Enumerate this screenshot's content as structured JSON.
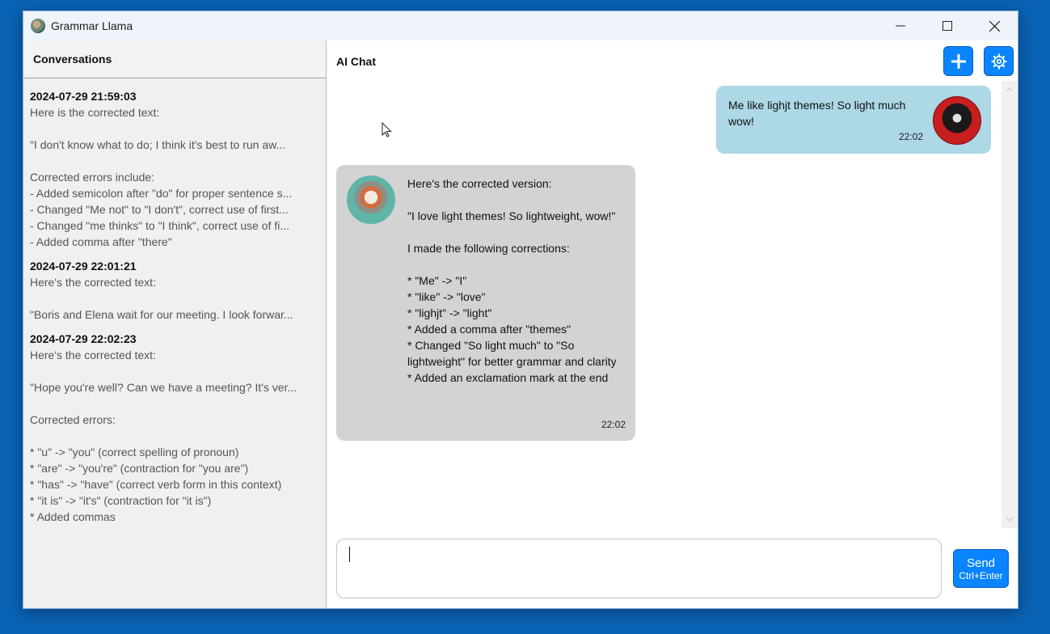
{
  "window": {
    "title": "Grammar Llama"
  },
  "sidebar": {
    "header": "Conversations",
    "conversations": [
      {
        "date": "2024-07-29 21:59:03",
        "lines": [
          "Here is the corrected text:",
          "",
          "\"I don't know what to do; I think it's best to run aw...",
          "",
          "Corrected errors include:",
          "- Added semicolon after \"do\" for proper sentence s...",
          "- Changed \"Me not\" to \"I don't\", correct use of first...",
          "- Changed \"me thinks\" to \"I think\", correct use of fi...",
          "- Added comma after \"there\""
        ]
      },
      {
        "date": "2024-07-29 22:01:21",
        "lines": [
          "Here's the corrected text:",
          "",
          "\"Boris and Elena wait for our meeting. I look forwar..."
        ]
      },
      {
        "date": "2024-07-29 22:02:23",
        "lines": [
          "Here's the corrected text:",
          "",
          "\"Hope you're well? Can we have a meeting? It's ver...",
          "",
          "Corrected errors:",
          "",
          "* \"u\" -> \"you\" (correct spelling of pronoun)",
          "* \"are\" -> \"you're\" (contraction for \"you are\")",
          "* \"has\" -> \"have\" (correct verb form in this context)",
          "* \"it is\" -> \"it's\" (contraction for \"it is\")",
          "* Added commas"
        ]
      }
    ]
  },
  "chat": {
    "title": "AI Chat",
    "messages": [
      {
        "role": "user",
        "text": "Me like lighjt themes! So light much wow!",
        "time": "22:02"
      },
      {
        "role": "assistant",
        "paragraphs": [
          "Here's the corrected version:",
          "",
          "\"I love light themes! So lightweight, wow!\"",
          "",
          "I made the following corrections:",
          "",
          "* \"Me\" -> \"I\"",
          "* \"like\" -> \"love\"",
          "* \"lighjt\" -> \"light\"",
          "* Added a comma after \"themes\"",
          "* Changed \"So light much\" to \"So lightweight\" for better grammar and clarity",
          "* Added an exclamation mark at the end"
        ],
        "time": "22:02"
      }
    ],
    "input": {
      "value": "",
      "placeholder": ""
    },
    "send": {
      "label": "Send",
      "shortcut": "Ctrl+Enter"
    }
  },
  "colors": {
    "accent": "#0a84ff",
    "user_bubble": "#add8e6",
    "assistant_bubble": "#d3d3d3"
  },
  "icons": {
    "new_chat": "plus-icon",
    "settings": "gear-icon"
  }
}
